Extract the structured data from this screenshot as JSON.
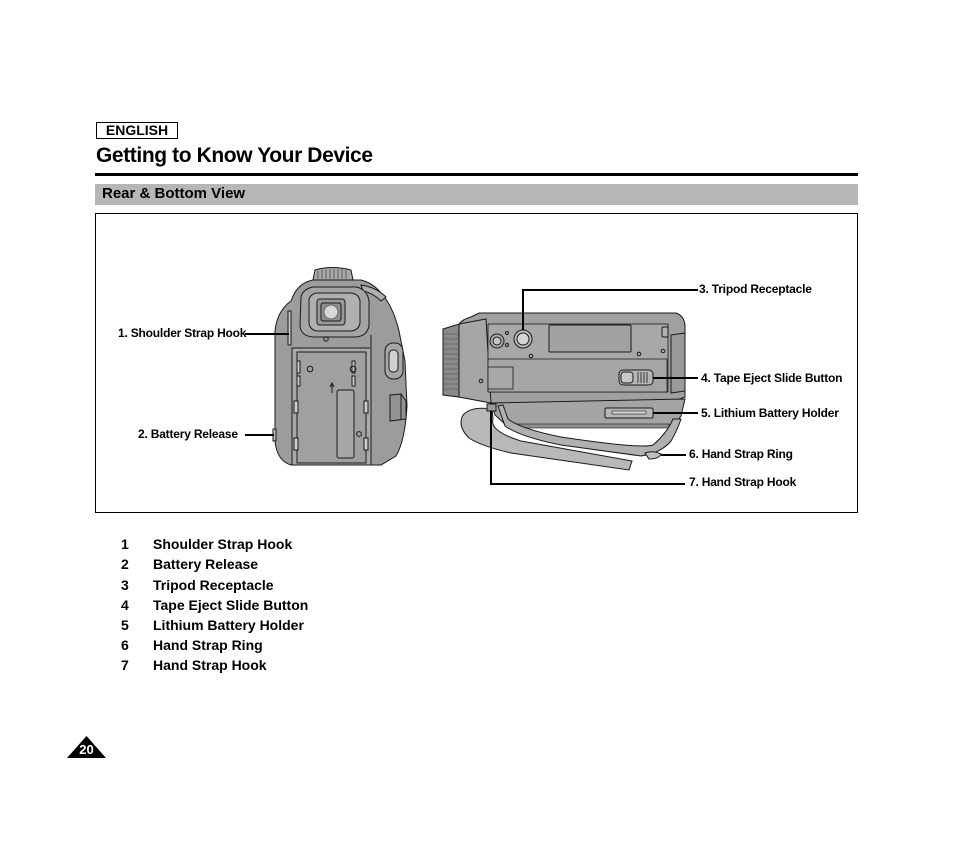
{
  "header": {
    "language_badge": "ENGLISH",
    "page_title": "Getting to Know Your Device"
  },
  "section": {
    "title": "Rear & Bottom View"
  },
  "figure": {
    "rear_view_callouts": [
      {
        "label": "1. Shoulder Strap Hook"
      },
      {
        "label": "2. Battery Release"
      }
    ],
    "bottom_view_callouts": [
      {
        "label": "3. Tripod Receptacle"
      },
      {
        "label": "4. Tape Eject Slide Button"
      },
      {
        "label": "5. Lithium Battery Holder"
      },
      {
        "label": "6. Hand Strap Ring"
      },
      {
        "label": "7. Hand Strap Hook"
      }
    ],
    "colors": {
      "body": "#9c9c9c",
      "body_light": "#b4b4b4",
      "outline": "#1a1a1a"
    }
  },
  "legend": {
    "items": [
      {
        "number": "1",
        "label": "Shoulder Strap Hook"
      },
      {
        "number": "2",
        "label": "Battery Release"
      },
      {
        "number": "3",
        "label": "Tripod Receptacle"
      },
      {
        "number": "4",
        "label": "Tape Eject Slide Button"
      },
      {
        "number": "5",
        "label": "Lithium Battery Holder"
      },
      {
        "number": "6",
        "label": "Hand Strap Ring"
      },
      {
        "number": "7",
        "label": "Hand Strap Hook"
      }
    ]
  },
  "footer": {
    "page_number": "20"
  }
}
